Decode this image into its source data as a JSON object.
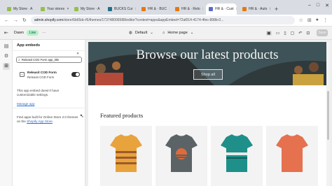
{
  "browser": {
    "tabs": [
      {
        "label": "My Store · A",
        "color": "#96bf48"
      },
      {
        "label": "Your stores",
        "color": "#96bf48"
      },
      {
        "label": "My Store · A",
        "color": "#96bf48"
      },
      {
        "label": "BUCKS Cur",
        "color": "#1f6f8b"
      },
      {
        "label": "HR & · BUC",
        "color": "#e47911"
      },
      {
        "label": "HR & · Relo",
        "color": "#e47911"
      },
      {
        "label": "HR & · Cust",
        "color": "#5c6ac4",
        "active": true
      },
      {
        "label": "HR & · Auto",
        "color": "#e47911"
      }
    ],
    "new_tab": "+",
    "window_controls": [
      "–",
      "□",
      "✕"
    ],
    "url_host": "admin.shopify.com",
    "url_path": "/store/6b65dc-f6/themes/173748006588/editor?context=apps&appEmbed=72af014-4174-4fec-898b-0..."
  },
  "editor": {
    "theme_name": "Dawn",
    "live_badge": "Live",
    "more": "···",
    "preset_label": "Default",
    "page_label": "Home page",
    "save_label": "Save",
    "tools": [
      "▣",
      "▭",
      "▯",
      "▢",
      "↶",
      "⊡"
    ]
  },
  "panel": {
    "title": "App embeds",
    "search_value": "Releasit COD Form app_title",
    "embed_name": "Releasit COD Form",
    "embed_sub": "Releasit COD Form",
    "embed_enabled": true,
    "note": "This app embed doesn't have customizable settings.",
    "manage_link": "Manage app",
    "find_text": "Find apps built for Online Store 2.0 themes on the",
    "find_link": "Shopify App Store",
    "find_end": "."
  },
  "preview": {
    "hero_title": "Browse our latest products",
    "shop_button": "Shop all",
    "featured_title": "Featured products",
    "products": [
      {
        "icon": "tshirt-striped-icon",
        "color": "#e8a33d"
      },
      {
        "icon": "tshirt-grey-icon",
        "color": "#5b6366"
      },
      {
        "icon": "tshirt-teal-icon",
        "color": "#1f8f8a"
      },
      {
        "icon": "tshirt-coral-icon",
        "color": "#e5714f"
      }
    ]
  }
}
